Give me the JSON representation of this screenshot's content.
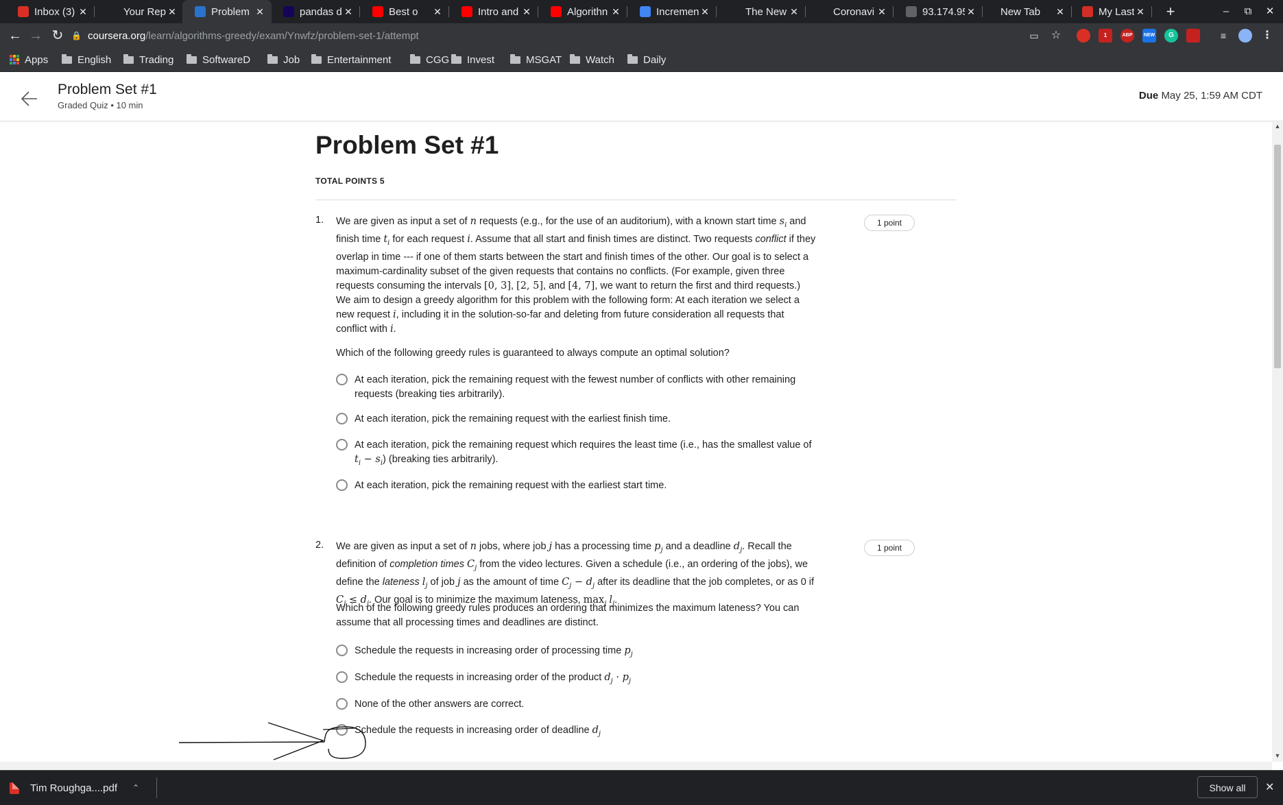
{
  "tabs": [
    {
      "label": "Inbox (3)",
      "icon": "gmail-icon",
      "color": "#d93025"
    },
    {
      "label": "Your Rep",
      "icon": "github-icon",
      "color": "#202124"
    },
    {
      "label": "Problem",
      "icon": "coursera-icon",
      "color": "#2a73cc",
      "active": true
    },
    {
      "label": "pandas d",
      "icon": "pandas-icon",
      "color": "#150458"
    },
    {
      "label": "Best o",
      "icon": "youtube-icon",
      "color": "#ff0000"
    },
    {
      "label": "Intro and",
      "icon": "youtube-icon",
      "color": "#ff0000"
    },
    {
      "label": "Algorithn",
      "icon": "youtube-icon",
      "color": "#ff0000"
    },
    {
      "label": "Incremen",
      "icon": "page-icon",
      "color": "#4285f4"
    },
    {
      "label": "The New",
      "icon": "nyt-icon",
      "color": "#202124"
    },
    {
      "label": "Coronavi",
      "icon": "nyt-icon",
      "color": "#202124"
    },
    {
      "label": "93.174.95",
      "icon": "globe-icon",
      "color": "#5f6368"
    },
    {
      "label": "New Tab",
      "icon": "",
      "color": ""
    },
    {
      "label": "My LastP",
      "icon": "lastpass-icon",
      "color": "#d32d27"
    }
  ],
  "address": {
    "host": "coursera.org",
    "path": "/learn/algorithms-greedy/exam/Ynwfz/problem-set-1/attempt"
  },
  "bookmarks": {
    "apps": "Apps",
    "folders": [
      "English",
      "Trading",
      "SoftwareD",
      "Job",
      "Entertainment",
      "CGG",
      "Invest",
      "MSGAT",
      "Watch",
      "Daily"
    ]
  },
  "extensions": {
    "ext_badge": "1",
    "abp": "ABP",
    "new_badge": "NEW"
  },
  "header": {
    "title": "Problem Set #1",
    "subtitle": "Graded Quiz • 10 min",
    "due_label": "Due",
    "due_value": "May 25, 1:59 AM CDT"
  },
  "quiz": {
    "title": "Problem Set #1",
    "total_points": "TOTAL POINTS 5",
    "q1": {
      "number": "1.",
      "points": "1 point",
      "prompt": "Which of the following greedy rules is guaranteed to always compute an optimal solution?",
      "options": [
        "At each iteration, pick the remaining request with the fewest number of conflicts with other remaining requests (breaking ties arbitrarily).",
        "At each iteration, pick the remaining request with the earliest finish time.",
        "At each iteration, pick the remaining request which requires the least time (i.e., has the smallest value of",
        "At each iteration, pick the remaining request with the earliest start time."
      ],
      "option3_suffix": ") (breaking ties arbitrarily)."
    },
    "q2": {
      "number": "2.",
      "points": "1 point",
      "prompt": "Which of the following greedy rules produces an ordering that minimizes the maximum lateness? You can assume that all processing times and deadlines are distinct.",
      "options": [
        "Schedule the requests in increasing order of processing time",
        "Schedule the requests in increasing order of the product",
        "None of the other answers are correct.",
        "Schedule the requests in increasing order of deadline"
      ]
    }
  },
  "downloads": {
    "file": "Tim Roughga....pdf",
    "show_all": "Show all"
  }
}
